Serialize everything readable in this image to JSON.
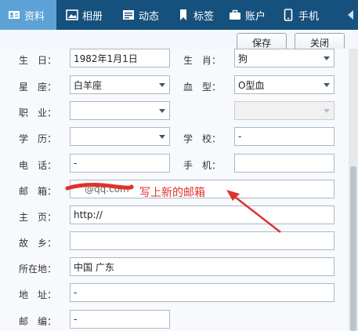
{
  "tabs": [
    {
      "label": "资料",
      "icon": "profile-card-icon",
      "active": true
    },
    {
      "label": "相册",
      "icon": "photo-icon",
      "active": false
    },
    {
      "label": "动态",
      "icon": "feed-icon",
      "active": false
    },
    {
      "label": "标签",
      "icon": "bookmark-icon",
      "active": false
    },
    {
      "label": "账户",
      "icon": "briefcase-icon",
      "active": false
    },
    {
      "label": "手机",
      "icon": "phone-icon",
      "active": false
    }
  ],
  "toolbar": {
    "save_label": "保存",
    "close_label": "关闭"
  },
  "form": {
    "birthday": {
      "label": "生　日：",
      "value": "1982年1月1日"
    },
    "zodiac": {
      "label": "生　肖：",
      "value": "狗"
    },
    "constellation": {
      "label": "星　座：",
      "value": "白羊座"
    },
    "blood_type": {
      "label": "血　型：",
      "value": "O型血"
    },
    "occupation": {
      "label": "职　业：",
      "value": ""
    },
    "education": {
      "label": "学　历：",
      "value": ""
    },
    "school": {
      "label": "学　校：",
      "value": "-"
    },
    "phone": {
      "label": "电　话：",
      "value": "-"
    },
    "mobile": {
      "label": "手　机：",
      "value": ""
    },
    "email": {
      "label": "邮　箱：",
      "value": "@qq.com"
    },
    "homepage": {
      "label": "主　页：",
      "value": "http://"
    },
    "hometown": {
      "label": "故　乡：",
      "value": ""
    },
    "location": {
      "label": "所在地：",
      "value": "中国  广东"
    },
    "address": {
      "label": "地　址：",
      "value": "-"
    },
    "postcode": {
      "label": "邮　编：",
      "value": "-"
    }
  },
  "annotation": {
    "text": "写上新的邮箱"
  },
  "colors": {
    "tabbar": "#16517e",
    "tab_active": "#5da2d6",
    "annotation": "#e0322d"
  }
}
